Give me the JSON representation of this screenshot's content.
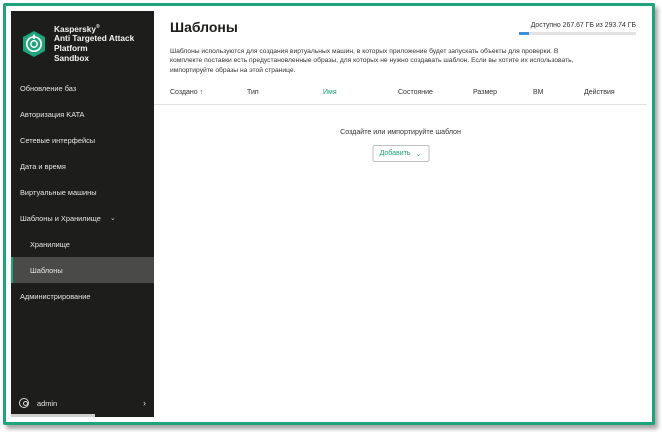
{
  "brand": {
    "name": "Kaspersky",
    "mark": "®",
    "line1": "Anti Targeted Attack",
    "line2": "Platform",
    "line3": "Sandbox"
  },
  "sidebar": {
    "items": [
      {
        "label": "Обновление баз"
      },
      {
        "label": "Авторизация KATA"
      },
      {
        "label": "Сетевые интерфейсы"
      },
      {
        "label": "Дата и время"
      },
      {
        "label": "Виртуальные машины"
      },
      {
        "label": "Шаблоны и Хранилище"
      },
      {
        "label": "Хранилище"
      },
      {
        "label": "Шаблоны"
      },
      {
        "label": "Администрирование"
      }
    ],
    "user": "admin",
    "icons": {
      "expand": "chevron-down-icon",
      "user": "user-icon",
      "user_menu": "chevron-right-icon"
    }
  },
  "main": {
    "title": "Шаблоны",
    "storage_text": "Доступно 267.67 ГБ из 293.74 ГБ",
    "storage_used_fraction": 0.089,
    "description": "Шаблоны используются для создания виртуальных машин, в которых приложение будет запускать объекты для проверки. В комплекте поставки есть предустановленные образы, для которых не нужно создавать шаблон. Если вы хотите их использовать, импортируйте образы на этой странице.",
    "columns": [
      "Создано ↑",
      "Тип",
      "Имя",
      "Состояние",
      "Размер",
      "ВМ",
      "Действия"
    ],
    "empty_text": "Создайте или импортируйте шаблон",
    "add_label": "Добавить"
  },
  "colors": {
    "accent": "#1fa37a",
    "sidebar": "#1d1d1b",
    "storage_bar": "#3c8fd6"
  }
}
